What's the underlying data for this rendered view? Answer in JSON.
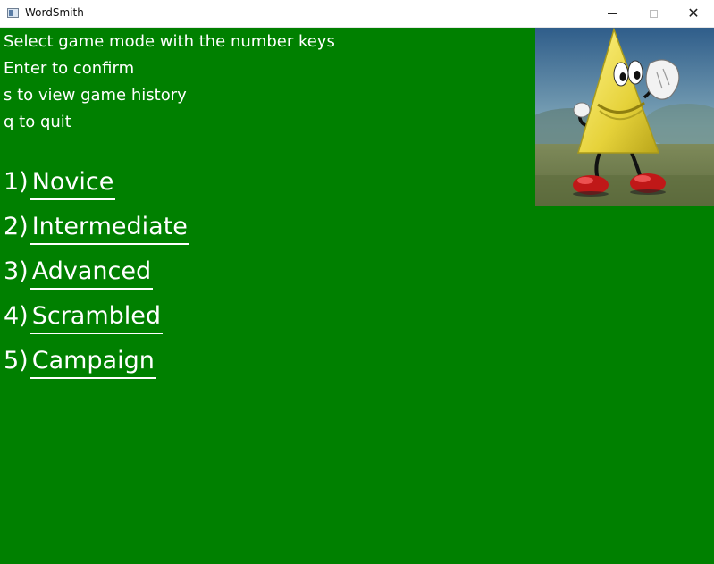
{
  "window": {
    "title": "WordSmith",
    "controls": {
      "minimize": "minimize-icon",
      "maximize": "maximize-icon",
      "close": "close-icon"
    }
  },
  "instructions": [
    "Select game mode with the number keys",
    "Enter to confirm",
    "s to view game history",
    "q to quit"
  ],
  "modes": [
    {
      "key": "1)",
      "label": "Novice"
    },
    {
      "key": "2)",
      "label": "Intermediate"
    },
    {
      "key": "3)",
      "label": "Advanced"
    },
    {
      "key": "4)",
      "label": "Scrambled"
    },
    {
      "key": "5)",
      "label": "Campaign"
    }
  ],
  "colors": {
    "background": "#008000",
    "text": "#ffffff",
    "titlebar": "#ffffff"
  },
  "mascot": {
    "icon": "triangle-mascot-icon"
  }
}
